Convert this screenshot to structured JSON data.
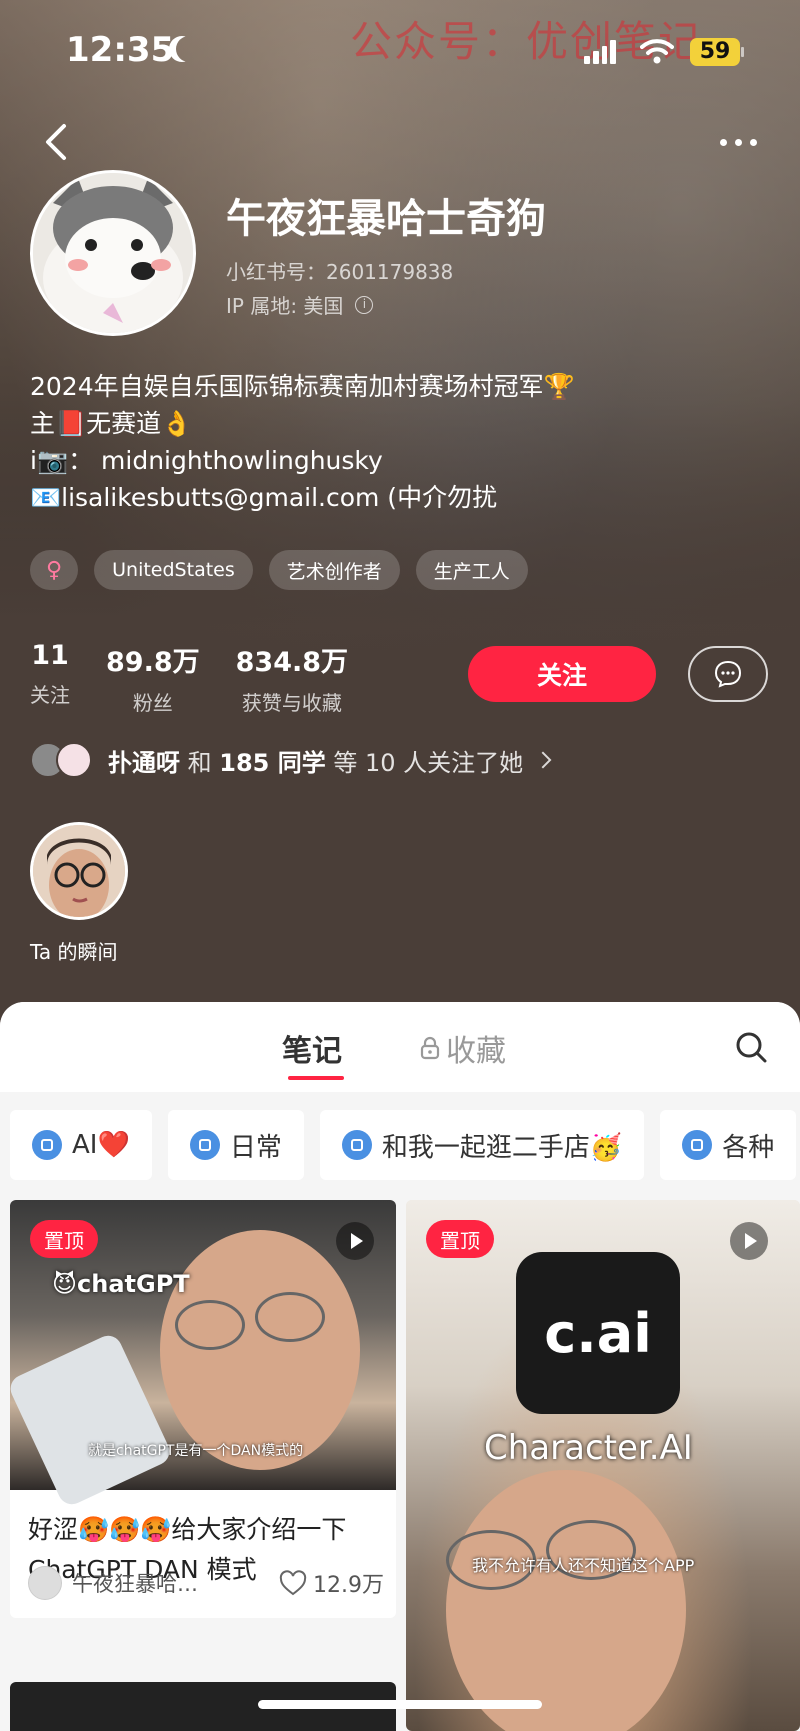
{
  "watermark": "公众号：优创笔记",
  "status_bar": {
    "time": "12:35",
    "battery": "59"
  },
  "profile": {
    "name": "午夜狂暴哈士奇狗",
    "red_id_label": "小红书号：",
    "red_id": "2601179838",
    "ip_location": "IP 属地: 美国",
    "bio": [
      "2024年自娱自乐国际锦标赛南加村赛场村冠军🏆",
      "主📕无赛道👌",
      "i📷：  midnighthowlinghusky",
      "📧lisalikesbutts@gmail.com (中介勿扰"
    ],
    "tags": [
      "♀",
      "UnitedStates",
      "艺术创作者",
      "生产工人"
    ]
  },
  "stats": [
    {
      "value": "11",
      "label": "关注"
    },
    {
      "value": "89.8万",
      "label": "粉丝"
    },
    {
      "value": "834.8万",
      "label": "获赞与收藏"
    }
  ],
  "actions": {
    "follow": "关注"
  },
  "mutual": {
    "name1": "扑通呀",
    "and": "和",
    "name2": "185 同学",
    "suffix": "等 10 人关注了她"
  },
  "moments": {
    "label": "Ta 的瞬间"
  },
  "tabs": {
    "notes": "笔记",
    "collect": "收藏"
  },
  "chips": [
    {
      "label": "AI❤️"
    },
    {
      "label": "日常"
    },
    {
      "label": "和我一起逛二手店🥳"
    },
    {
      "label": "各种"
    }
  ],
  "cards": [
    {
      "badge": "置顶",
      "overlay": "😈chatGPT",
      "subtitle": "就是chatGPT是有一个DAN模式的",
      "title": "好涩🥵🥵🥵给大家介绍一下ChatGPT DAN 模式",
      "author": "午夜狂暴哈…",
      "likes": "12.9万"
    },
    {
      "badge": "置顶",
      "logo_text": "c.ai",
      "overlay": "Character.AI",
      "subtitle": "我不允许有人还不知道这个APP"
    }
  ],
  "colors": {
    "accent": "#ff2442",
    "background": "#4a3e38",
    "sheet": "#f5f5f5"
  }
}
